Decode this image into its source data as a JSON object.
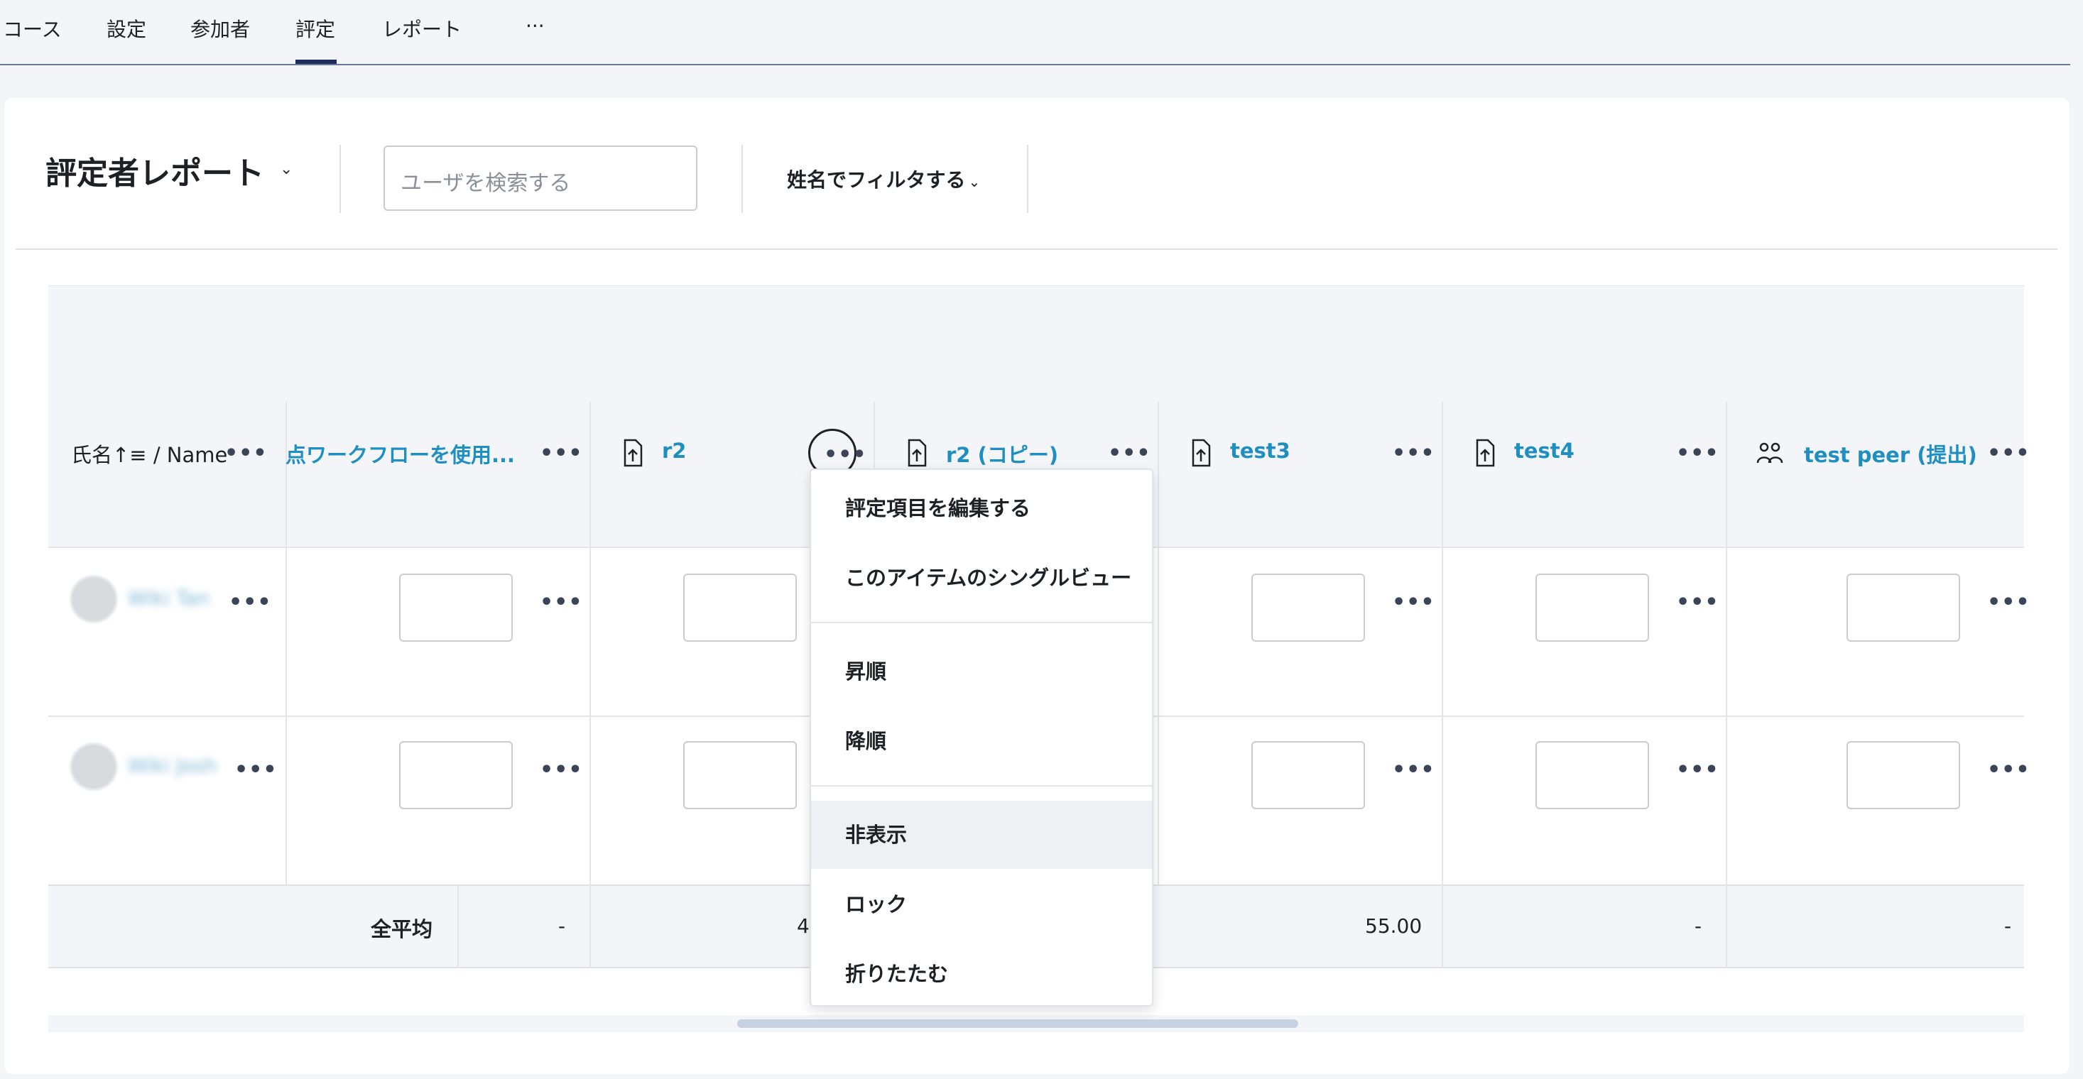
{
  "nav": {
    "tabs": [
      "コース",
      "設定",
      "参加者",
      "評定",
      "レポート",
      "···"
    ],
    "active_tab": "評定"
  },
  "toolbar": {
    "report_title": "評定者レポート",
    "search_placeholder": "ユーザを検索する",
    "filter_label": "姓名でフィルタする"
  },
  "grid": {
    "name_header": "氏名↑≡ / Name",
    "columns": [
      {
        "title": "点ワークフローを使用...",
        "icon": "none"
      },
      {
        "title": "r2",
        "icon": "file-upload-icon"
      },
      {
        "title": "r2 (コピー)",
        "icon": "file-upload-icon"
      },
      {
        "title": "test3",
        "icon": "file-upload-icon"
      },
      {
        "title": "test4",
        "icon": "file-upload-icon"
      },
      {
        "title": "test peer (提出)",
        "icon": "peer-icon"
      }
    ],
    "users": [
      {
        "name": "Wiki Tan"
      },
      {
        "name": "Wiki Josh"
      }
    ],
    "overall_average_label": "全平均",
    "averages": [
      "-",
      "4",
      "55.00",
      "-",
      "-"
    ]
  },
  "menu": {
    "items": [
      "評定項目を編集する",
      "このアイテムのシングルビュー",
      "昇順",
      "降順",
      "非表示",
      "ロック",
      "折りたたむ"
    ],
    "highlighted": "非表示"
  },
  "dots_glyph": "•••",
  "colors": {
    "link": "#1f8fc1",
    "active_tab_underline": "#1e2e5c",
    "page_bg": "#f4f5f8"
  }
}
